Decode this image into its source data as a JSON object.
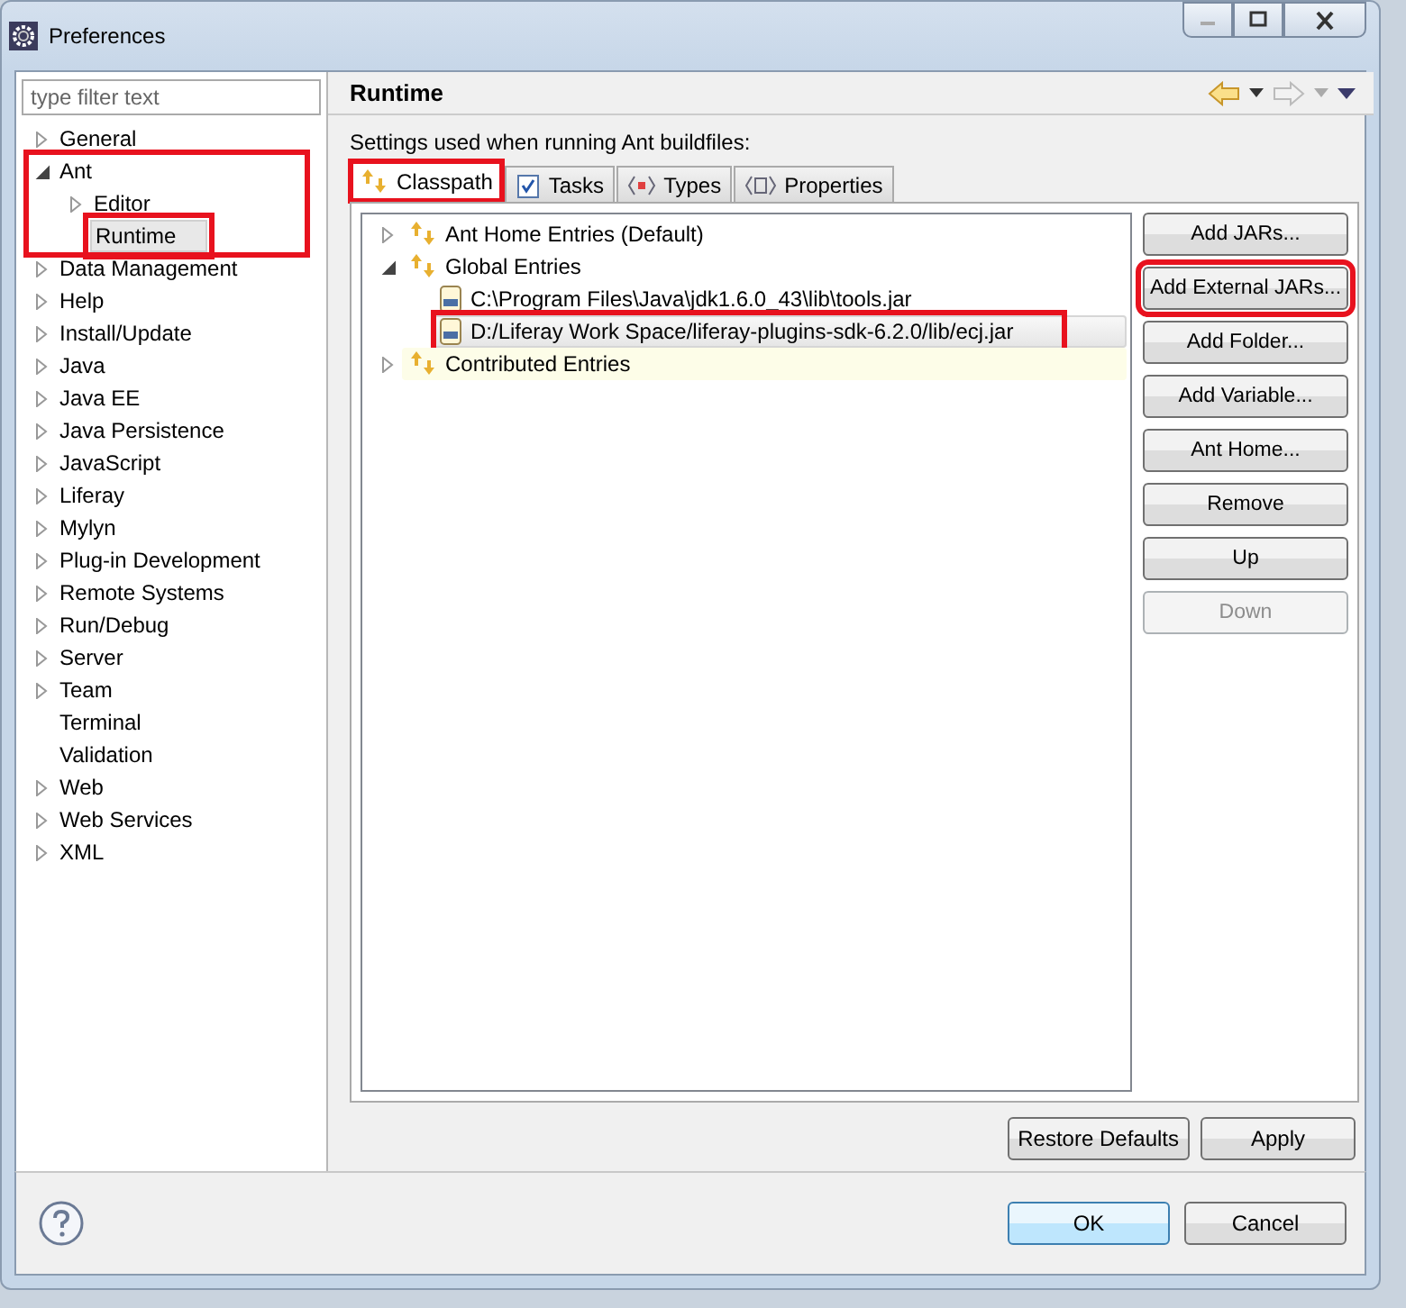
{
  "window": {
    "title": "Preferences"
  },
  "filter": {
    "placeholder": "type filter text"
  },
  "tree": [
    {
      "label": "General",
      "expandable": true,
      "expanded": false,
      "selected": false,
      "highlighted": false
    },
    {
      "label": "Ant",
      "expandable": true,
      "expanded": true,
      "selected": false,
      "highlighted": true,
      "children": [
        {
          "label": "Editor",
          "expandable": true,
          "expanded": false,
          "selected": false,
          "highlighted": false
        },
        {
          "label": "Runtime",
          "expandable": false,
          "selected": true,
          "highlighted": true
        }
      ]
    },
    {
      "label": "Data Management",
      "expandable": true,
      "expanded": false,
      "selected": false,
      "highlighted": false
    },
    {
      "label": "Help",
      "expandable": true,
      "expanded": false,
      "selected": false,
      "highlighted": false
    },
    {
      "label": "Install/Update",
      "expandable": true,
      "expanded": false,
      "selected": false,
      "highlighted": false
    },
    {
      "label": "Java",
      "expandable": true,
      "expanded": false,
      "selected": false,
      "highlighted": false
    },
    {
      "label": "Java EE",
      "expandable": true,
      "expanded": false,
      "selected": false,
      "highlighted": false
    },
    {
      "label": "Java Persistence",
      "expandable": true,
      "expanded": false,
      "selected": false,
      "highlighted": false
    },
    {
      "label": "JavaScript",
      "expandable": true,
      "expanded": false,
      "selected": false,
      "highlighted": false
    },
    {
      "label": "Liferay",
      "expandable": true,
      "expanded": false,
      "selected": false,
      "highlighted": false
    },
    {
      "label": "Mylyn",
      "expandable": true,
      "expanded": false,
      "selected": false,
      "highlighted": false
    },
    {
      "label": "Plug-in Development",
      "expandable": true,
      "expanded": false,
      "selected": false,
      "highlighted": false
    },
    {
      "label": "Remote Systems",
      "expandable": true,
      "expanded": false,
      "selected": false,
      "highlighted": false
    },
    {
      "label": "Run/Debug",
      "expandable": true,
      "expanded": false,
      "selected": false,
      "highlighted": false
    },
    {
      "label": "Server",
      "expandable": true,
      "expanded": false,
      "selected": false,
      "highlighted": false
    },
    {
      "label": "Team",
      "expandable": true,
      "expanded": false,
      "selected": false,
      "highlighted": false
    },
    {
      "label": "Terminal",
      "expandable": false,
      "selected": false,
      "highlighted": false
    },
    {
      "label": "Validation",
      "expandable": false,
      "selected": false,
      "highlighted": false
    },
    {
      "label": "Web",
      "expandable": true,
      "expanded": false,
      "selected": false,
      "highlighted": false
    },
    {
      "label": "Web Services",
      "expandable": true,
      "expanded": false,
      "selected": false,
      "highlighted": false
    },
    {
      "label": "XML",
      "expandable": true,
      "expanded": false,
      "selected": false,
      "highlighted": false
    }
  ],
  "page": {
    "title": "Runtime",
    "description": "Settings used when running Ant buildfiles:"
  },
  "tabs": [
    {
      "label": "Classpath",
      "kind": "classpath",
      "selected": true,
      "highlighted": true
    },
    {
      "label": "Tasks",
      "kind": "tasks",
      "selected": false,
      "highlighted": false
    },
    {
      "label": "Types",
      "kind": "types",
      "selected": false,
      "highlighted": false
    },
    {
      "label": "Properties",
      "kind": "properties",
      "selected": false,
      "highlighted": false
    }
  ],
  "classpath": [
    {
      "label": "Ant Home Entries (Default)",
      "kind": "group",
      "expandable": true,
      "expanded": false,
      "selected": false,
      "hovered": false,
      "highlighted": false
    },
    {
      "label": "Global Entries",
      "kind": "group",
      "expandable": true,
      "expanded": true,
      "selected": false,
      "hovered": false,
      "highlighted": false,
      "children": [
        {
          "label": "C:\\Program Files\\Java\\jdk1.6.0_43\\lib\\tools.jar",
          "kind": "jar",
          "expandable": false,
          "selected": false,
          "hovered": false,
          "highlighted": false
        },
        {
          "label": "D:/Liferay Work Space/liferay-plugins-sdk-6.2.0/lib/ecj.jar",
          "kind": "jar",
          "expandable": false,
          "selected": true,
          "hovered": false,
          "highlighted": true
        }
      ]
    },
    {
      "label": "Contributed Entries",
      "kind": "group",
      "expandable": true,
      "expanded": false,
      "selected": false,
      "hovered": true,
      "highlighted": false
    }
  ],
  "side_buttons": [
    {
      "label": "Add JARs...",
      "disabled": false,
      "highlighted": false
    },
    {
      "label": "Add External JARs...",
      "disabled": false,
      "highlighted": true
    },
    {
      "label": "Add Folder...",
      "disabled": false,
      "highlighted": false
    },
    {
      "label": "Add Variable...",
      "disabled": false,
      "highlighted": false
    },
    {
      "label": "Ant Home...",
      "disabled": false,
      "highlighted": false
    },
    {
      "label": "Remove",
      "disabled": false,
      "highlighted": false
    },
    {
      "label": "Up",
      "disabled": false,
      "highlighted": false
    },
    {
      "label": "Down",
      "disabled": true,
      "highlighted": false
    }
  ],
  "page_buttons": [
    "Restore Defaults",
    "Apply"
  ],
  "dialog_buttons": [
    {
      "label": "OK",
      "default": true
    },
    {
      "label": "Cancel",
      "default": false
    }
  ]
}
